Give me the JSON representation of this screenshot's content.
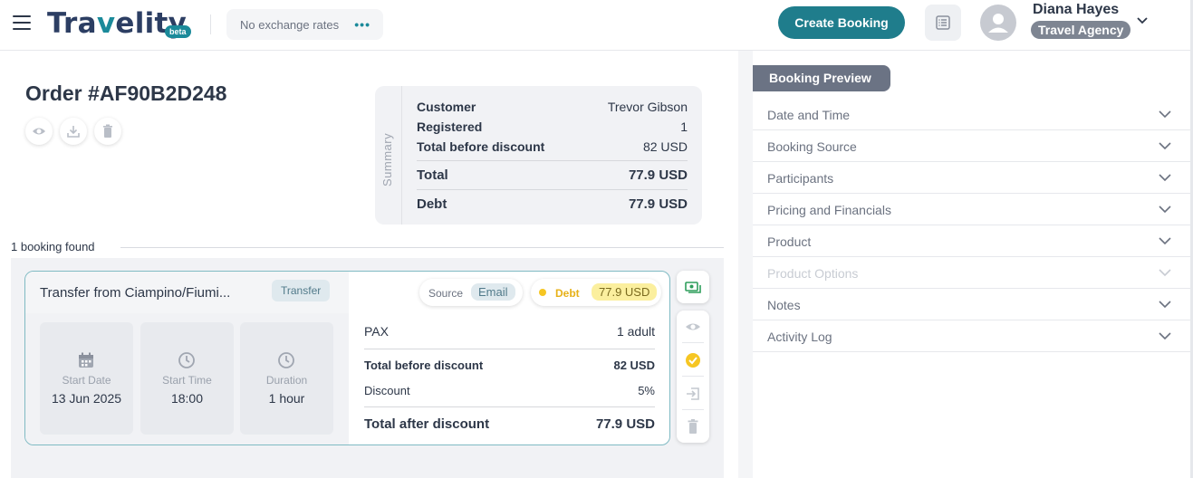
{
  "header": {
    "logo_text_1": "Tra",
    "logo_text_accent": "v",
    "logo_text_2": "elity",
    "beta_label": "beta",
    "exchange_rates": "No exchange rates",
    "exchange_more": "•••",
    "create_booking_label": "Create Booking",
    "user": {
      "name": "Diana Hayes",
      "role": "Travel Agency"
    }
  },
  "order": {
    "title": "Order #AF90B2D248"
  },
  "summary": {
    "tab_label": "Summary",
    "rows": [
      {
        "label": "Customer",
        "value": "Trevor Gibson"
      },
      {
        "label": "Registered",
        "value": "1"
      },
      {
        "label": "Total before discount",
        "value": "82 USD"
      },
      {
        "label": "Total",
        "value": "77.9 USD"
      },
      {
        "label": "Debt",
        "value": "77.9 USD"
      }
    ]
  },
  "bookings_found": "1 booking found",
  "booking": {
    "title": "Transfer from Ciampino/Fiumi...",
    "type_tag": "Transfer",
    "tiles": [
      {
        "label": "Start Date",
        "value": "13 Jun 2025",
        "icon": "calendar-icon"
      },
      {
        "label": "Start Time",
        "value": "18:00",
        "icon": "clock-icon"
      },
      {
        "label": "Duration",
        "value": "1 hour",
        "icon": "clock-icon"
      }
    ],
    "source_label": "Source",
    "source_value": "Email",
    "debt_label": "Debt",
    "debt_value": "77.9 USD",
    "pax_label": "PAX",
    "pax_value": "1 adult",
    "total_before_label": "Total before discount",
    "total_before_value": "82 USD",
    "discount_label": "Discount",
    "discount_value": "5%",
    "total_after_label": "Total after discount",
    "total_after_value": "77.9 USD"
  },
  "preview": {
    "tab_label": "Booking Preview",
    "sections": [
      {
        "label": "Date and Time",
        "disabled": false
      },
      {
        "label": "Booking Source",
        "disabled": false
      },
      {
        "label": "Participants",
        "disabled": false
      },
      {
        "label": "Pricing and Financials",
        "disabled": false
      },
      {
        "label": "Product",
        "disabled": false
      },
      {
        "label": "Product Options",
        "disabled": true
      },
      {
        "label": "Notes",
        "disabled": false
      },
      {
        "label": "Activity Log",
        "disabled": false
      }
    ]
  },
  "colors": {
    "brand": "#1b8a9a",
    "primary_button": "#1f7d8c",
    "debt_yellow": "#f6c623",
    "card_border": "#7fbac3"
  }
}
